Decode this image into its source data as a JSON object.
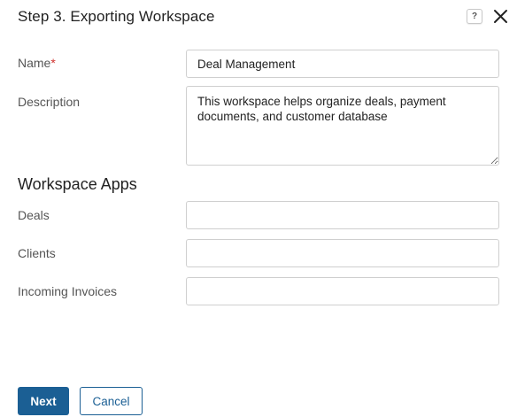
{
  "dialog": {
    "title": "Step 3. Exporting Workspace",
    "help_icon": "help-icon",
    "close_icon": "close-icon"
  },
  "form": {
    "name_label": "Name",
    "name_required_mark": "*",
    "name_value": "Deal Management",
    "description_label": "Description",
    "description_value": "This workspace helps organize deals, payment documents, and customer database"
  },
  "apps_section": {
    "title": "Workspace Apps",
    "fields": [
      {
        "label": "Deals",
        "value": ""
      },
      {
        "label": "Clients",
        "value": ""
      },
      {
        "label": "Incoming Invoices",
        "value": ""
      }
    ]
  },
  "footer": {
    "next_label": "Next",
    "cancel_label": "Cancel"
  },
  "colors": {
    "primary": "#1b5f94",
    "required": "#d0312d",
    "border": "#cfcfcf"
  }
}
